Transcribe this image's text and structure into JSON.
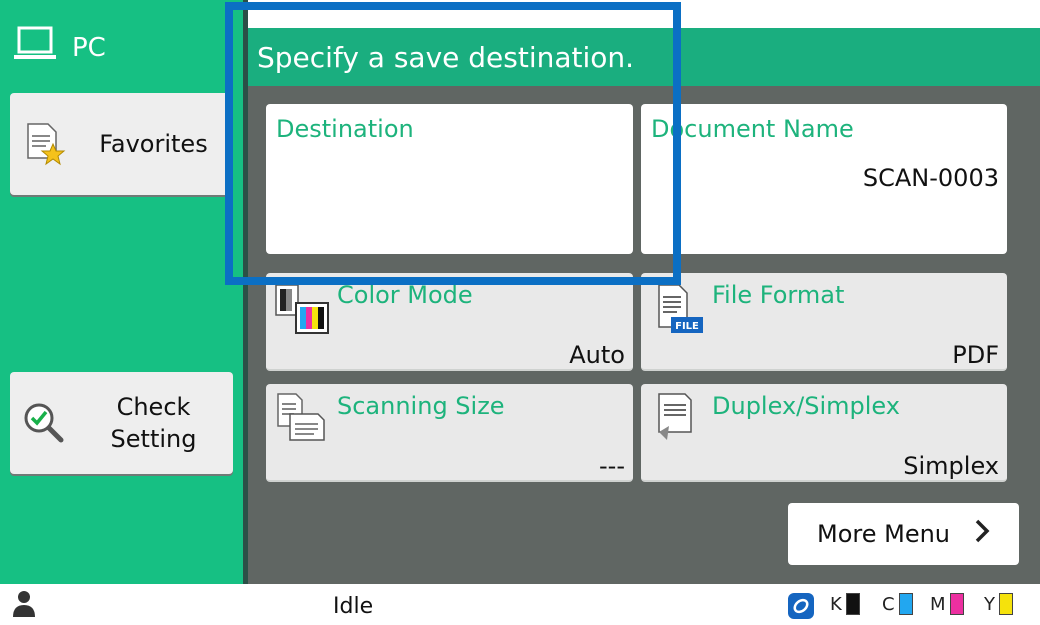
{
  "sidebar": {
    "header_label": "PC",
    "favorites_label": "Favorites",
    "check_setting_label": "Check\nSetting"
  },
  "banner": {
    "text": "Specify a save destination."
  },
  "cards": {
    "destination": {
      "title": "Destination",
      "value": ""
    },
    "document_name": {
      "title": "Document Name",
      "value": "SCAN-0003"
    },
    "color_mode": {
      "title": "Color Mode",
      "value": "Auto"
    },
    "file_format": {
      "title": "File Format",
      "value": "PDF",
      "icon_badge": "FILE"
    },
    "scanning_size": {
      "title": "Scanning Size",
      "value": "---"
    },
    "duplex_simplex": {
      "title": "Duplex/Simplex",
      "value": "Simplex"
    }
  },
  "more_menu": {
    "label": "More Menu"
  },
  "status": {
    "text": "Idle",
    "toners": [
      {
        "label": "K",
        "color": "#111111"
      },
      {
        "label": "C",
        "color": "#22a7f0"
      },
      {
        "label": "M",
        "color": "#ec2fa0"
      },
      {
        "label": "Y",
        "color": "#f5e20c"
      }
    ]
  },
  "colors": {
    "accent": "#16c083",
    "banner": "#1aae7f",
    "highlight": "#0b6fc4",
    "title_text": "#1db37c"
  }
}
